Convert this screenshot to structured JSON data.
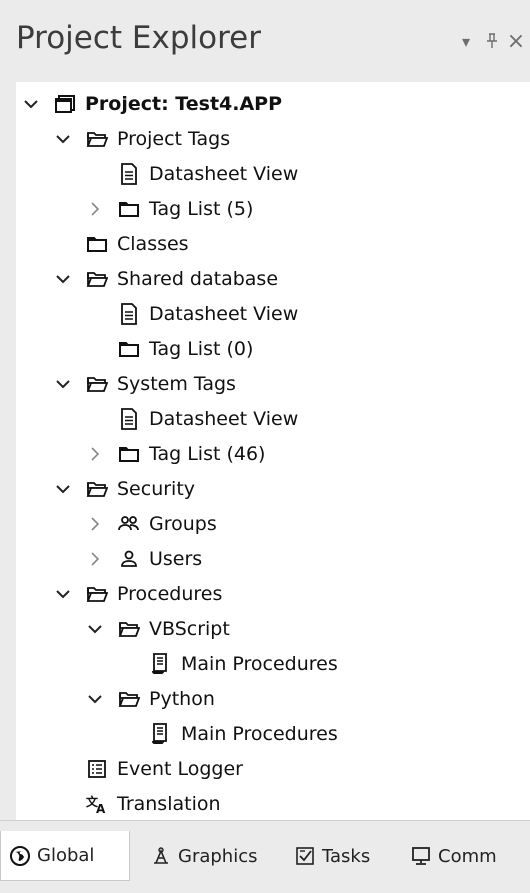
{
  "panel": {
    "title": "Project Explorer",
    "dropdown_glyph": "▾",
    "pin_glyph": "⊥",
    "close_glyph": "×"
  },
  "tree": [
    {
      "label": "Project: Test4.APP",
      "icon": "project-icon",
      "expanded": true,
      "bold": true
    },
    {
      "label": "Project Tags",
      "icon": "folder-open-icon",
      "expanded": true
    },
    {
      "label": "Datasheet View",
      "icon": "document-icon"
    },
    {
      "label": "Tag List (5)",
      "icon": "folder-closed-icon",
      "expanded": false
    },
    {
      "label": "Classes",
      "icon": "folder-closed-icon"
    },
    {
      "label": "Shared database",
      "icon": "folder-open-icon",
      "expanded": true
    },
    {
      "label": "Datasheet View",
      "icon": "document-icon"
    },
    {
      "label": "Tag List (0)",
      "icon": "folder-closed-icon"
    },
    {
      "label": "System Tags",
      "icon": "folder-open-icon",
      "expanded": true
    },
    {
      "label": "Datasheet View",
      "icon": "document-icon"
    },
    {
      "label": "Tag List (46)",
      "icon": "folder-closed-icon",
      "expanded": false
    },
    {
      "label": "Security",
      "icon": "folder-open-icon",
      "expanded": true
    },
    {
      "label": "Groups",
      "icon": "groups-icon",
      "expanded": false
    },
    {
      "label": "Users",
      "icon": "user-icon",
      "expanded": false
    },
    {
      "label": "Procedures",
      "icon": "folder-open-icon",
      "expanded": true
    },
    {
      "label": "VBScript",
      "icon": "folder-open-icon",
      "expanded": true
    },
    {
      "label": "Main Procedures",
      "icon": "script-icon"
    },
    {
      "label": "Python",
      "icon": "folder-open-icon",
      "expanded": true
    },
    {
      "label": "Main Procedures",
      "icon": "script-icon"
    },
    {
      "label": "Event Logger",
      "icon": "event-logger-icon"
    },
    {
      "label": "Translation",
      "icon": "translation-icon"
    }
  ],
  "tabs": [
    {
      "label": "Global",
      "icon": "global-icon",
      "active": true
    },
    {
      "label": "Graphics",
      "icon": "graphics-icon"
    },
    {
      "label": "Tasks",
      "icon": "tasks-icon"
    },
    {
      "label": "Comm",
      "icon": "comm-icon"
    }
  ]
}
